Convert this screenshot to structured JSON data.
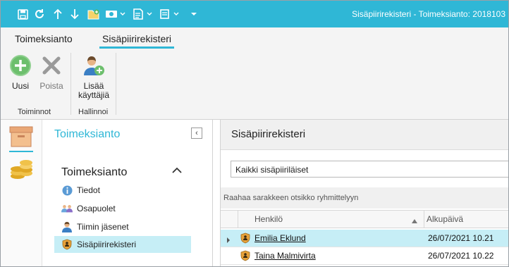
{
  "window": {
    "title": "Sisäpiirirekisteri - Toimeksianto: 2018103"
  },
  "ribbon_tabs": [
    {
      "label": "Toimeksianto"
    },
    {
      "label": "Sisäpiirirekisteri"
    }
  ],
  "ribbon": {
    "uusi_label": "Uusi",
    "poista_label": "Poista",
    "lisaa_label_1": "Lisää",
    "lisaa_label_2": "käyttäjiä",
    "group_toiminnot": "Toiminnot",
    "group_hallinnoi": "Hallinnoi"
  },
  "nav": {
    "header": "Toimeksianto",
    "section": "Toimeksianto",
    "items": [
      {
        "label": "Tiedot",
        "icon": "info-icon"
      },
      {
        "label": "Osapuolet",
        "icon": "people-icon"
      },
      {
        "label": "Tiimin jäsenet",
        "icon": "team-icon"
      },
      {
        "label": "Sisäpiirirekisteri",
        "icon": "shield-icon"
      }
    ]
  },
  "main": {
    "title": "Sisäpiirirekisteri",
    "filter_value": "Kaikki sisäpiiriläiset",
    "group_hint": "Raahaa sarakkeen otsikko ryhmittelyyn",
    "columns": [
      "Henkilö",
      "Alkupäivä"
    ],
    "rows": [
      {
        "name": "Emilia Eklund",
        "date": "26/07/2021 10.21"
      },
      {
        "name": "Taina Malmivirta",
        "date": "26/07/2021 10.22"
      }
    ]
  },
  "colors": {
    "accent": "#2fb7d6",
    "selection": "#c6eef6",
    "shield": "#e8a23a"
  }
}
